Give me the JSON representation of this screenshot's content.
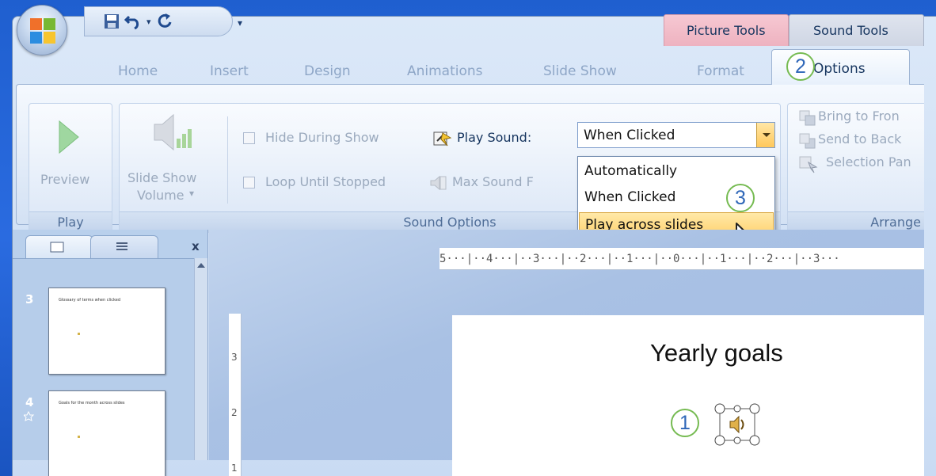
{
  "qat": {
    "dropdown": "▾"
  },
  "contextual": {
    "picture_tools": "Picture Tools",
    "sound_tools": "Sound Tools"
  },
  "tabs": [
    "Home",
    "Insert",
    "Design",
    "Animations",
    "Slide Show",
    "Format",
    "Options"
  ],
  "callouts": {
    "one": "1",
    "two": "2",
    "three": "3"
  },
  "ribbon": {
    "play": {
      "button": "Preview",
      "group": "Play"
    },
    "sound_options": {
      "volume_line1": "Slide Show",
      "volume_line2": "Volume",
      "volume_arrow": "▾",
      "hide_during_show": "Hide During Show",
      "loop_until_stopped": "Loop Until Stopped",
      "play_sound_label": "Play Sound:",
      "play_sound_value": "When Clicked",
      "max_sound": "Max Sound F",
      "group": "Sound Options"
    },
    "arrange": {
      "bring_to_front": "Bring to Fron",
      "send_to_back": "Send to Back",
      "selection_pane": "Selection Pan",
      "group": "Arrange"
    }
  },
  "dropdown_options": [
    "Automatically",
    "When Clicked",
    "Play across slides"
  ],
  "dropdown_selected_index": 2,
  "panes": {
    "close": "x",
    "thumbnails": [
      {
        "number": "3",
        "text": "Glossary of terms when clicked"
      },
      {
        "number": "4",
        "text": "Goals for the month across slides"
      }
    ]
  },
  "ruler": {
    "horizontal": "5···|··4···|··3···|··2···|··1···|··0···|··1···|··2···|··3···",
    "v3": "3",
    "v2": "2",
    "v1": "1"
  },
  "slide": {
    "title": "Yearly goals"
  }
}
